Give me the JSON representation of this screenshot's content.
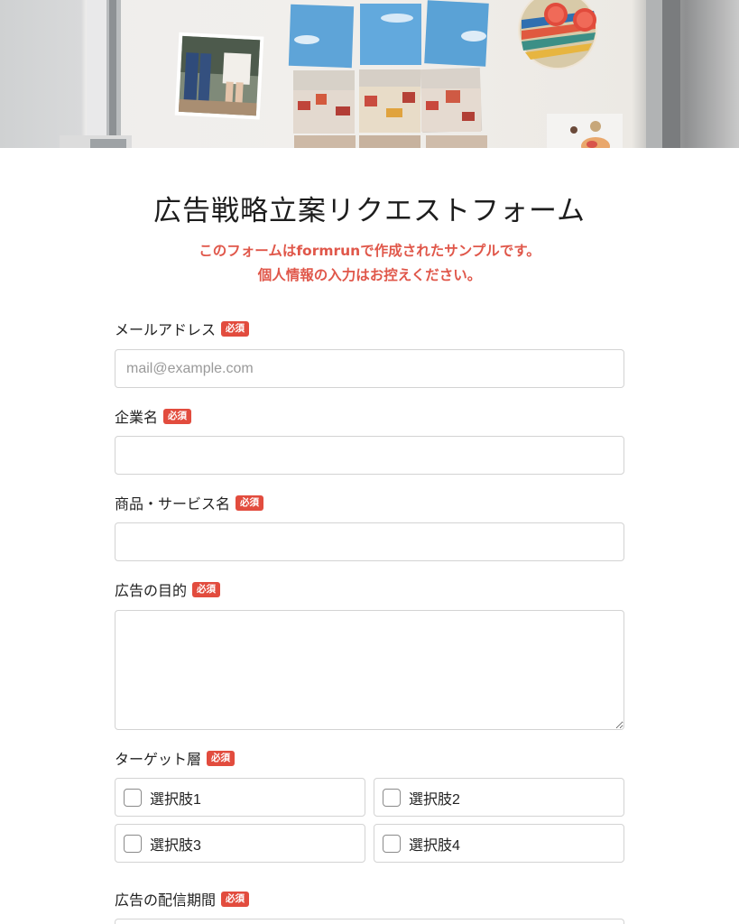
{
  "form": {
    "title": "広告戦略立案リクエストフォーム",
    "notice_line1": "このフォームはformrunで作成されたサンプルです。",
    "notice_line2": "個人情報の入力はお控えください。",
    "required_badge": "必須",
    "accent_color": "#e24c3e"
  },
  "fields": {
    "email": {
      "label": "メールアドレス",
      "placeholder": "mail@example.com",
      "value": ""
    },
    "company": {
      "label": "企業名",
      "value": ""
    },
    "product": {
      "label": "商品・サービス名",
      "value": ""
    },
    "purpose": {
      "label": "広告の目的",
      "value": ""
    },
    "target": {
      "label": "ターゲット層",
      "options": [
        "選択肢1",
        "選択肢2",
        "選択肢3",
        "選択肢4"
      ]
    },
    "period": {
      "label": "広告の配信期間"
    }
  }
}
